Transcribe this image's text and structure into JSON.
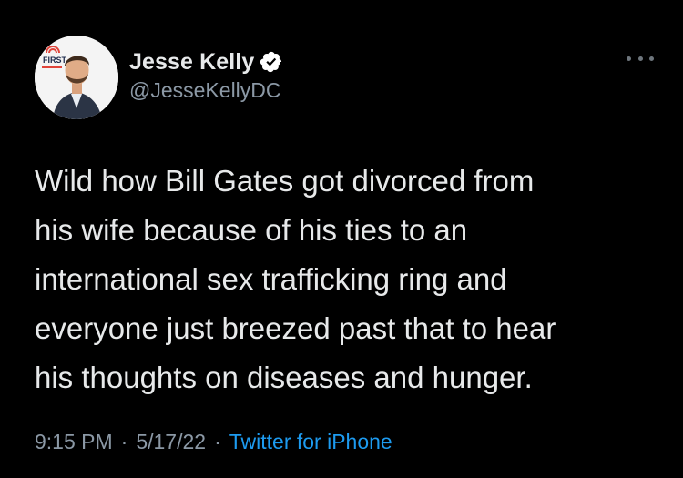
{
  "author": {
    "display_name": "Jesse Kelly",
    "handle": "@JesseKellyDC",
    "verified": true,
    "avatar_badge": "FIRST"
  },
  "tweet": {
    "text": "Wild how Bill Gates got divorced from\nhis wife because of his ties to an\ninternational sex trafficking ring and\neveryone just breezed past that to hear\nhis thoughts on diseases and hunger.",
    "time": "9:15 PM",
    "date": "5/17/22",
    "separator": "·",
    "source": "Twitter for iPhone"
  },
  "icons": {
    "verified": "verified-badge-icon",
    "more": "more-options-icon"
  },
  "colors": {
    "background": "#000000",
    "text": "#e7e9ea",
    "muted": "#8b98a5",
    "link": "#1d9bf0"
  }
}
